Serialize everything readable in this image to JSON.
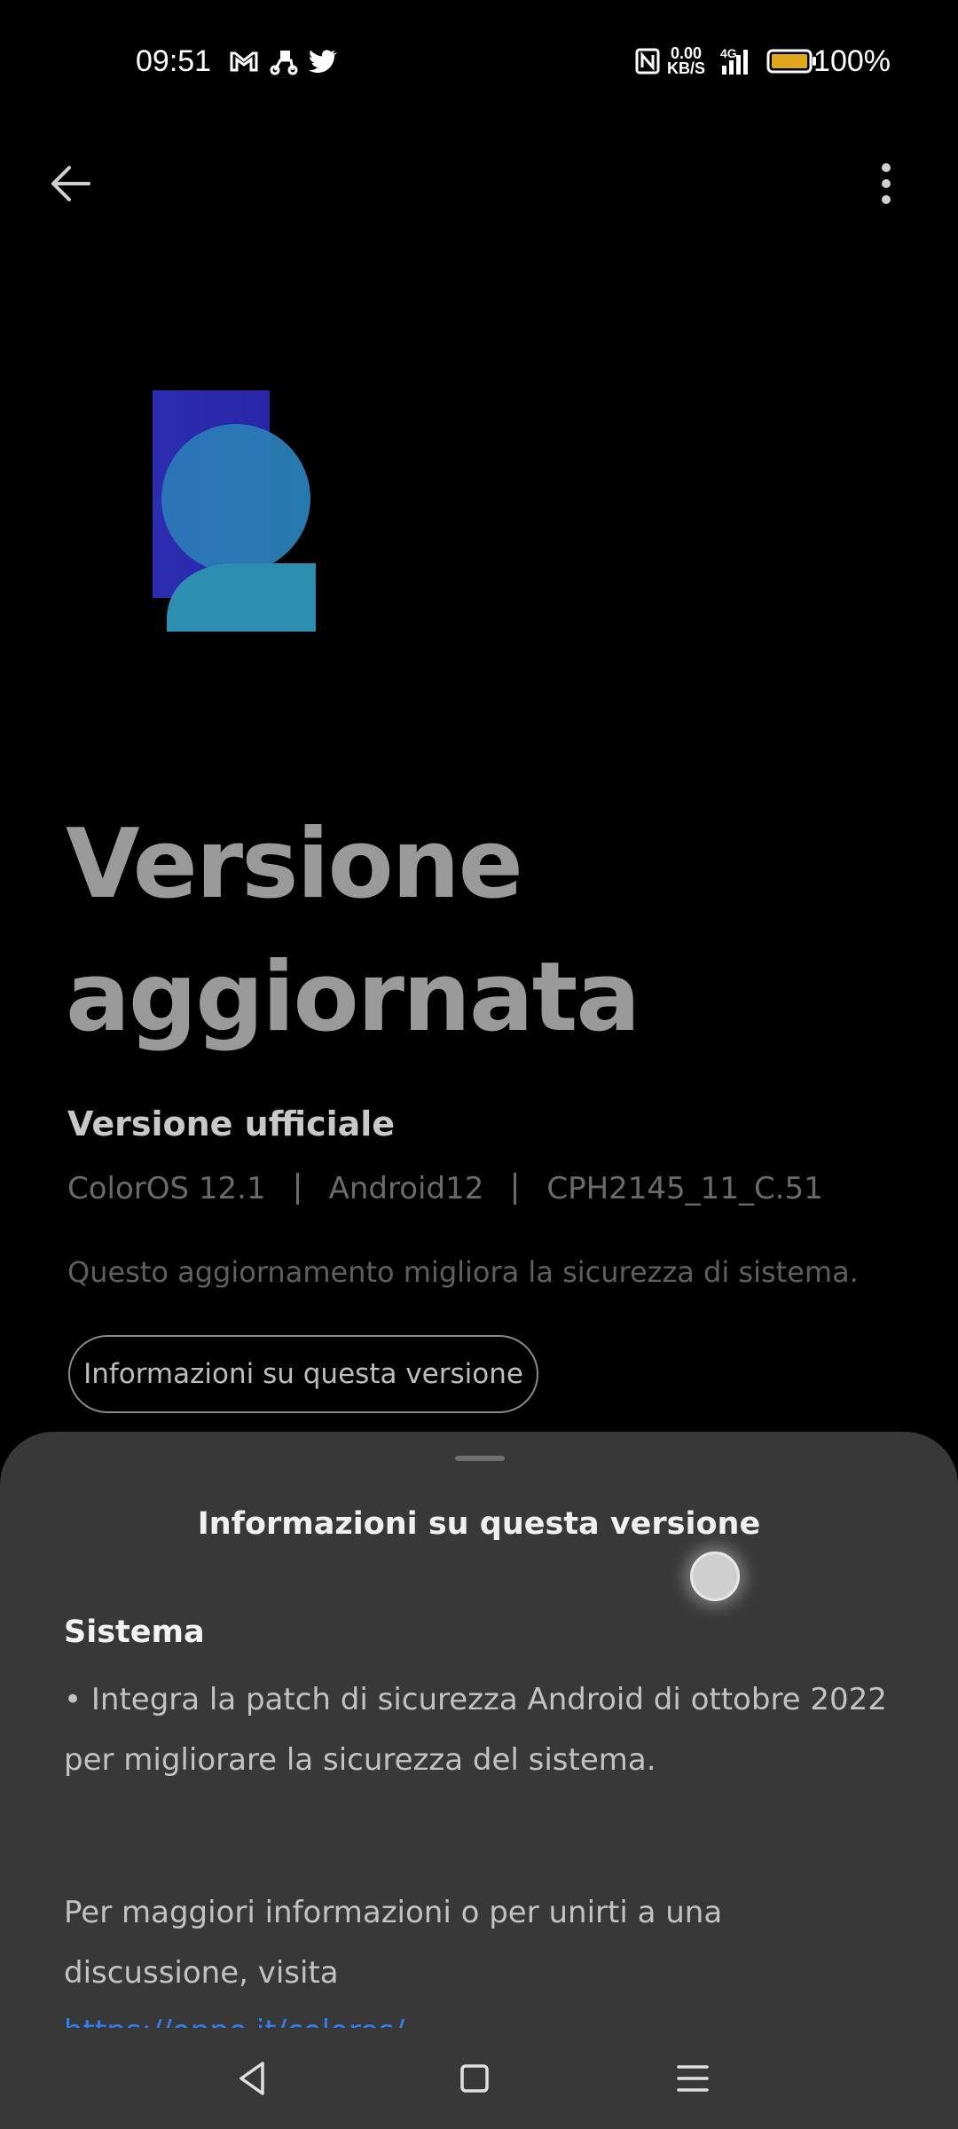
{
  "status_bar": {
    "time": "09:51",
    "net_speed_value": "0.00",
    "net_speed_unit": "KB/S",
    "network_type": "4G",
    "battery_percent": "100%",
    "battery_level": 1.0,
    "battery_color": "#e0a81c",
    "notification_icons": [
      "gmail-icon",
      "delivery-icon",
      "twitter-icon"
    ],
    "system_icons": [
      "nfc-icon",
      "signal-icon",
      "battery-icon"
    ]
  },
  "header": {
    "back_icon": "arrow-left-icon",
    "more_icon": "more-vertical-icon"
  },
  "main": {
    "headline_line1": "Versione",
    "headline_line2": "aggiornata",
    "subtitle": "Versione ufficiale",
    "os_version": "ColorOS 12.1",
    "android_version": "Android12",
    "build_number": "CPH2145_11_C.51",
    "description": "Questo aggiornamento migliora la sicurezza di sistema.",
    "info_button_label": "Informazioni su questa versione"
  },
  "sheet": {
    "title": "Informazioni su questa versione",
    "section_title": "Sistema",
    "bullet_text": "• Integra la patch di sicurezza Android di ottobre 2022 per migliorare la sicurezza del sistema.",
    "more_info_text": "Per maggiori informazioni o per unirti a una discussione, visita",
    "link_text": "https://oppo.it/coloros/"
  },
  "nav": {
    "back_icon": "nav-back-icon",
    "home_icon": "nav-home-icon",
    "recents_icon": "nav-menu-icon"
  }
}
